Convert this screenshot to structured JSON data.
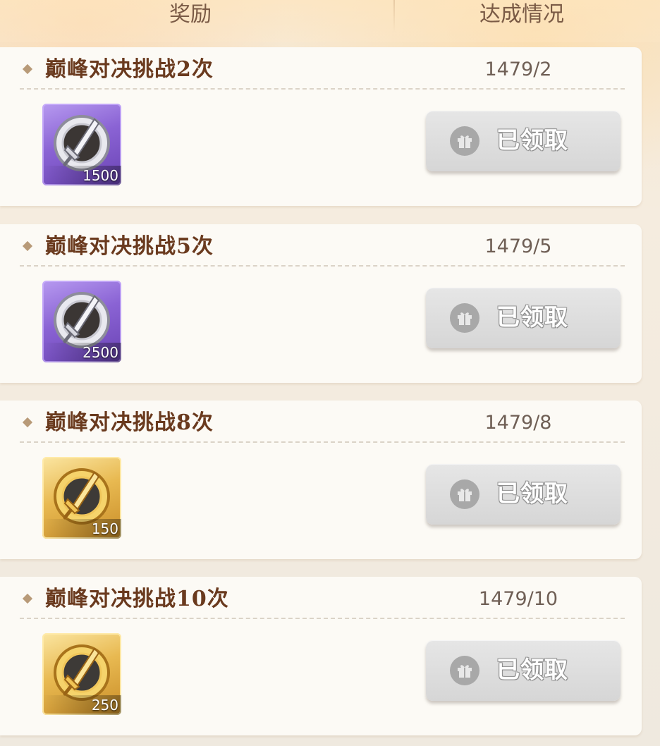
{
  "header": {
    "reward_label": "奖励",
    "status_label": "达成情况"
  },
  "tasks": [
    {
      "title": "巅峰对决挑战2次",
      "progress": "1479/2",
      "reward": {
        "icon": "silver-sword-coin-icon",
        "tier": "purple",
        "count": "1500"
      },
      "button_label": "已领取"
    },
    {
      "title": "巅峰对决挑战5次",
      "progress": "1479/5",
      "reward": {
        "icon": "silver-sword-coin-icon",
        "tier": "purple",
        "count": "2500"
      },
      "button_label": "已领取"
    },
    {
      "title": "巅峰对决挑战8次",
      "progress": "1479/8",
      "reward": {
        "icon": "gold-sword-coin-icon",
        "tier": "gold",
        "count": "150"
      },
      "button_label": "已领取"
    },
    {
      "title": "巅峰对决挑战10次",
      "progress": "1479/10",
      "reward": {
        "icon": "gold-sword-coin-icon",
        "tier": "gold",
        "count": "250"
      },
      "button_label": "已领取"
    }
  ],
  "colors": {
    "title": "#6a3a1e",
    "purple_tier": "#8a63d4",
    "gold_tier": "#e8b951",
    "claimed_button": "#d6d6d6"
  }
}
